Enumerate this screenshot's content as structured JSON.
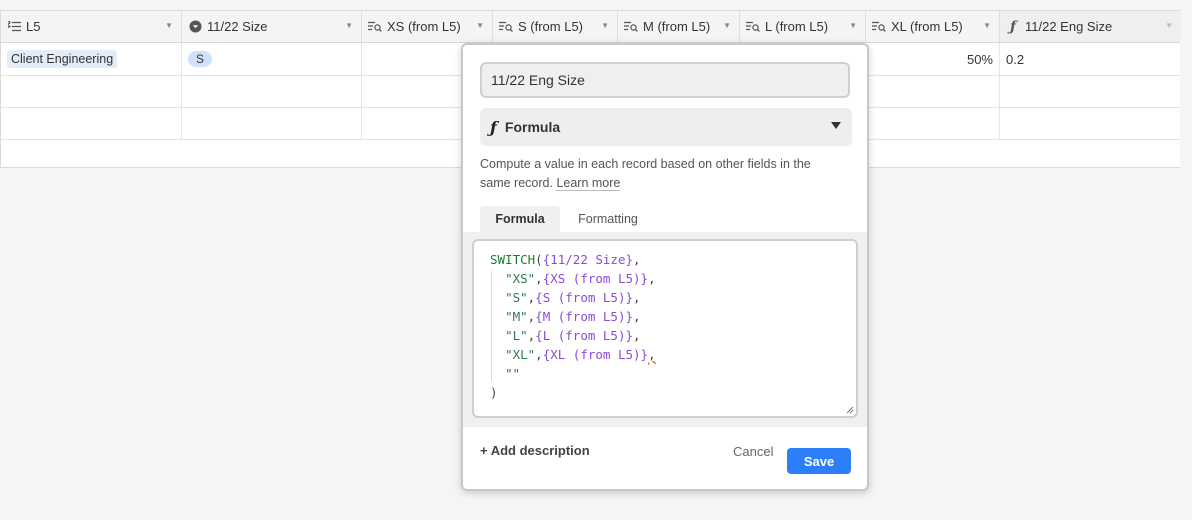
{
  "grid": {
    "columns": [
      {
        "label": "L5",
        "icon": "linked-record-icon"
      },
      {
        "label": "11/22 Size",
        "icon": "single-select-icon"
      },
      {
        "label": "XS (from L5)",
        "icon": "lookup-icon"
      },
      {
        "label": "S (from L5)",
        "icon": "lookup-icon"
      },
      {
        "label": "M (from L5)",
        "icon": "lookup-icon"
      },
      {
        "label": "L (from L5)",
        "icon": "lookup-icon"
      },
      {
        "label": "XL (from L5)",
        "icon": "lookup-icon"
      },
      {
        "label": "11/22 Eng Size",
        "icon": "formula-icon"
      }
    ],
    "rows": [
      {
        "l5": "Client Engineering",
        "size": "S",
        "xl": "50%",
        "eng_size": "0.2"
      }
    ]
  },
  "field_editor": {
    "name_value": "11/22 Eng Size",
    "type_label": "Formula",
    "type_icon": "formula-icon",
    "description_text": "Compute a value in each record based on other fields in the same record.",
    "learn_more": "Learn more",
    "tabs": [
      "Formula",
      "Formatting"
    ],
    "active_tab": "Formula",
    "formula": {
      "fn": "SWITCH",
      "field": "{11/22 Size}",
      "cases": [
        {
          "key": "\"XS\"",
          "value": "{XS (from L5)}"
        },
        {
          "key": "\"S\"",
          "value": "{S (from L5)}"
        },
        {
          "key": "\"M\"",
          "value": "{M (from L5)}"
        },
        {
          "key": "\"L\"",
          "value": "{L (from L5)}"
        },
        {
          "key": "\"XL\"",
          "value": "{XL (from L5)}"
        }
      ],
      "default": "\"\"",
      "close": ")"
    },
    "add_description": "+ Add description",
    "cancel": "Cancel",
    "save": "Save"
  },
  "colors": {
    "accent": "#2d7ff9",
    "formula_function": "#1a7f2e",
    "formula_field": "#8c4bd6",
    "formula_string": "#2f7a52"
  }
}
